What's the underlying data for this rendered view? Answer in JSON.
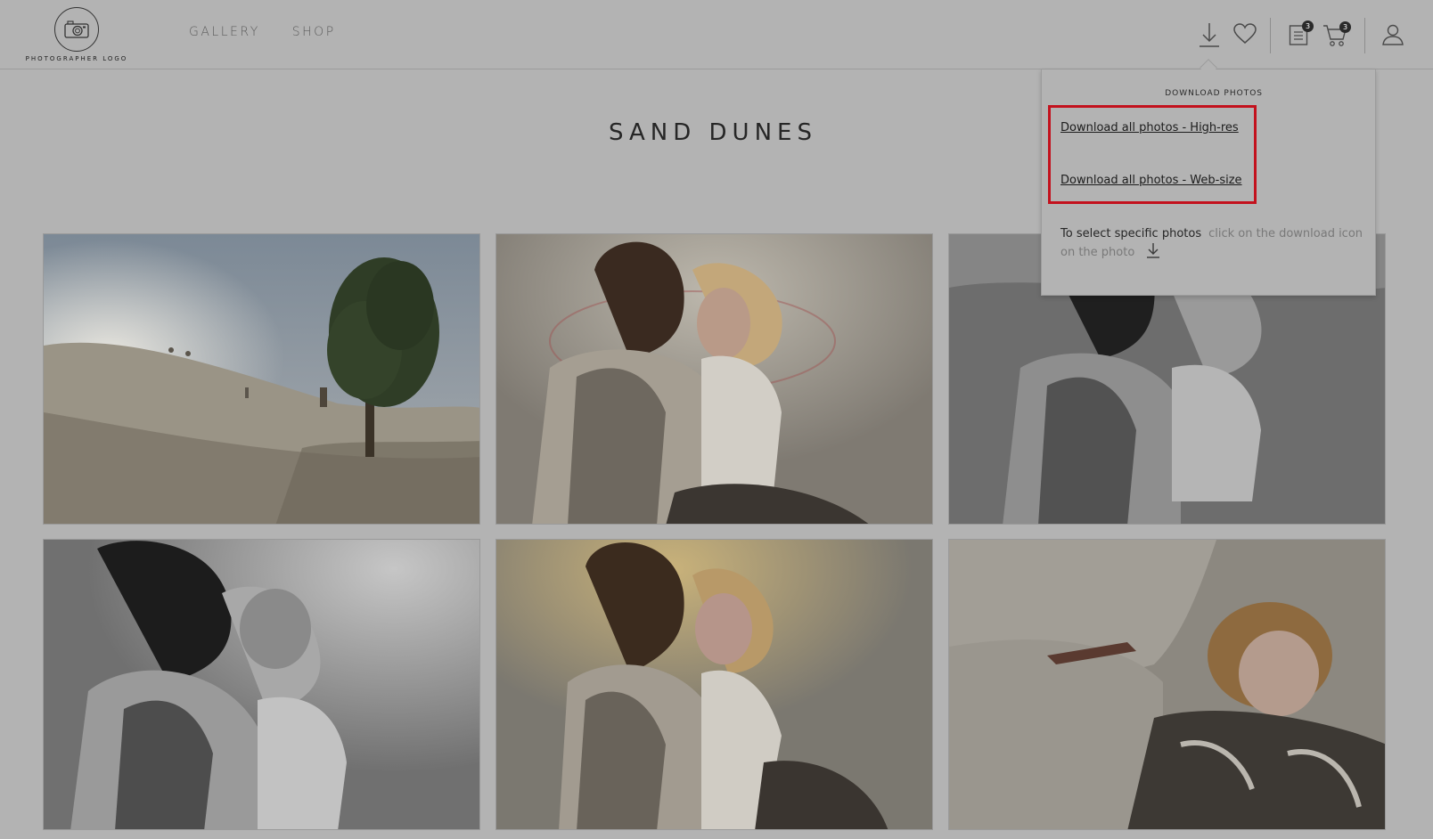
{
  "header": {
    "logo_text": "PHOTOGRAPHER LOGO",
    "nav": [
      {
        "label": "GALLERY"
      },
      {
        "label": "SHOP"
      }
    ],
    "icons": {
      "download": "download-icon",
      "favorites": "heart-icon",
      "order": "clipboard-icon",
      "cart": "cart-icon",
      "account": "user-icon"
    },
    "order_badge": "3",
    "cart_badge": "3"
  },
  "page_title": "SAND DUNES",
  "download_menu": {
    "heading": "DOWNLOAD PHOTOS",
    "high_res_label": "Download all photos - High-res",
    "web_size_label": "Download all photos - Web-size",
    "help_strong": "To select specific photos",
    "help_text": "click on the download icon on the photo",
    "highlight_color": "#c3111d"
  },
  "photos": [
    {
      "name": "Tree on the dune with running children"
    },
    {
      "name": "Mother hugging daughter in sunlight"
    },
    {
      "name": "Mother and daughter black and white"
    },
    {
      "name": "Mother kissing daughter's head black and white"
    },
    {
      "name": "Mother and daughter smiling at sunset"
    },
    {
      "name": "Girl resting on mother's lap"
    }
  ],
  "colors": {
    "overlay_bg": "#b3b3b3",
    "text_dark": "#262626",
    "highlight": "#c3111d"
  }
}
